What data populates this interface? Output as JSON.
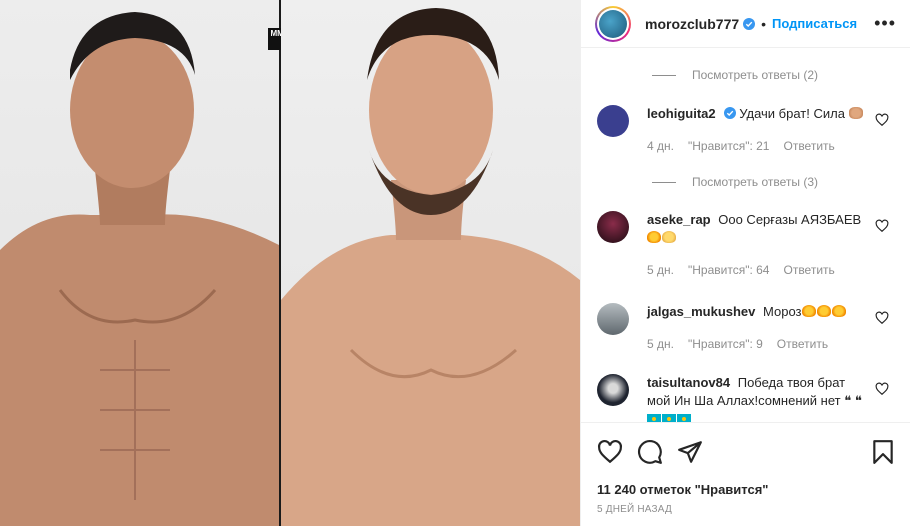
{
  "header": {
    "username": "morozclub777",
    "follow_label": "Подписаться",
    "more_label": "•••"
  },
  "media": {
    "logo_text": "MMA"
  },
  "comments": [
    {
      "type": "replies",
      "label": "Посмотреть ответы (2)"
    },
    {
      "type": "comment",
      "user": "leohiguita2",
      "verified": true,
      "text": "Удачи брат! Сила",
      "emoji": [
        "flex"
      ],
      "age": "4 дн.",
      "likes": "\"Нравится\": 21",
      "reply": "Ответить",
      "avatar_color": "#3a3f8f"
    },
    {
      "type": "replies",
      "label": "Посмотреть ответы (3)"
    },
    {
      "type": "comment",
      "user": "aseke_rap",
      "verified": false,
      "text": "Ооо Серғазы АЯЗБАЕВ",
      "emoji": [
        "fire",
        "clap"
      ],
      "age": "5 дн.",
      "likes": "\"Нравится\": 64",
      "reply": "Ответить",
      "avatar_color": "#2a0f18"
    },
    {
      "type": "comment",
      "user": "jalgas_mukushev",
      "verified": false,
      "text": "Мороз",
      "emoji": [
        "fire",
        "fire",
        "fire"
      ],
      "age": "5 дн.",
      "likes": "\"Нравится\": 9",
      "reply": "Ответить",
      "avatar_color": "#7f8a90"
    },
    {
      "type": "comment",
      "user": "taisultanov84",
      "verified": false,
      "text": "Победа твоя брат мой Ин Ша Аллах!сомнений нет",
      "emoji": [],
      "age": "",
      "likes": "",
      "reply": "",
      "avatar_color": "#1f2430"
    }
  ],
  "likes_count": "11 240 отметок \"Нравится\"",
  "post_date": "5 ДНЕЙ НАЗАД",
  "colors": {
    "accent": "#0095f6",
    "verified": "#3897f0",
    "muted": "#8e8e8e",
    "text": "#262626"
  }
}
